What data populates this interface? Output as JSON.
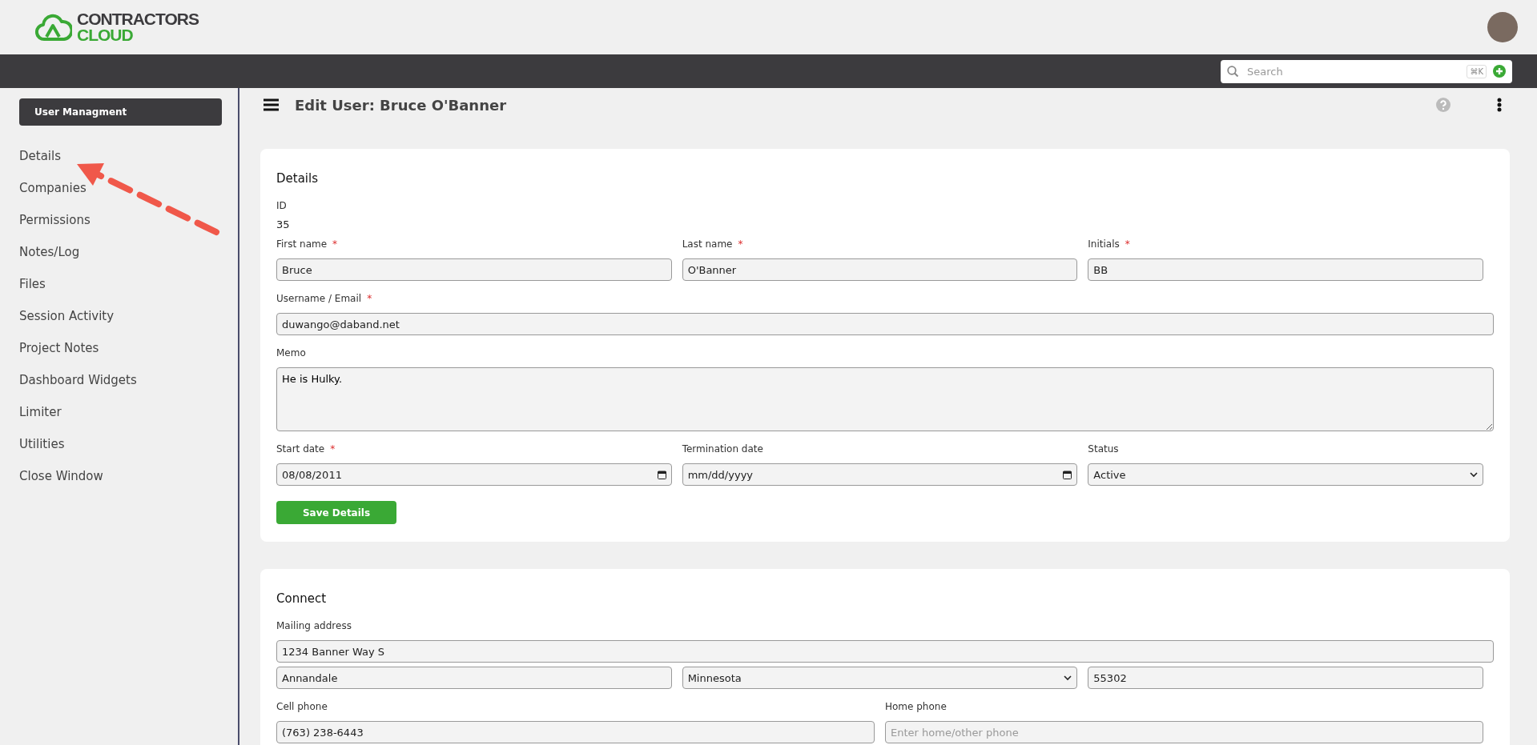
{
  "logo": {
    "line_1": "CONTRACTORS",
    "line_2": "CLOUD"
  },
  "search": {
    "placeholder": "Search",
    "shortcut": "⌘K"
  },
  "sidebar": {
    "heading": "User Managment",
    "items": [
      "Details",
      "Companies",
      "Permissions",
      "Notes/Log",
      "Files",
      "Session Activity",
      "Project Notes",
      "Dashboard Widgets",
      "Limiter",
      "Utilities",
      "Close Window"
    ]
  },
  "page_title": "Edit User: Bruce O'Banner",
  "sections": [
    {
      "title": "Details",
      "id_label": "ID",
      "id_value": "35",
      "rows": [
        {
          "fields": [
            {
              "kind": "text",
              "label": "First name",
              "required_mark": "*",
              "value": "Bruce"
            },
            {
              "kind": "text",
              "label": "Last name",
              "required_mark": "*",
              "value": "O'Banner"
            },
            {
              "kind": "text",
              "label": "Initials",
              "required_mark": "*",
              "value": "BB"
            }
          ]
        },
        {
          "fields": [
            {
              "kind": "text",
              "label": "Username / Email",
              "required_mark": "*",
              "value": "duwango@daband.net"
            }
          ]
        },
        {
          "fields": [
            {
              "kind": "textarea",
              "label": "Memo",
              "value": "He is Hulky."
            }
          ]
        },
        {
          "fields": [
            {
              "kind": "date",
              "label": "Start date",
              "required_mark": "*",
              "value": "08/08/2011"
            },
            {
              "kind": "date",
              "label": "Termination date",
              "placeholder": "mm/dd/yyyy"
            },
            {
              "kind": "select",
              "label": "Status",
              "value": "Active"
            }
          ]
        }
      ],
      "button": "Save Details"
    },
    {
      "title": "Connect",
      "rows": [
        {
          "fields": [
            {
              "kind": "text",
              "label": "Mailing address",
              "value": "1234 Banner Way S"
            }
          ]
        },
        {
          "fields": [
            {
              "kind": "text",
              "value": "Annandale"
            },
            {
              "kind": "select",
              "value": "Minnesota"
            },
            {
              "kind": "text",
              "value": "55302"
            }
          ]
        },
        {
          "fields": [
            {
              "kind": "text",
              "label": "Cell phone",
              "value": "(763) 238-6443"
            },
            {
              "kind": "text",
              "label": "Home phone",
              "placeholder": "Enter home/other phone"
            }
          ]
        }
      ]
    }
  ]
}
